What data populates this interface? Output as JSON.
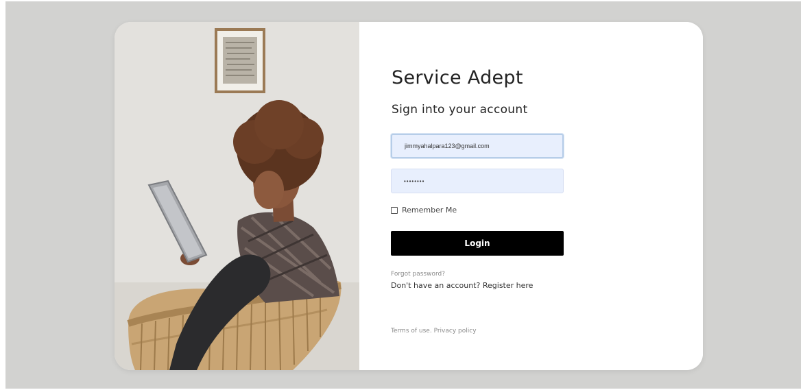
{
  "brand": {
    "title": "Service Adept"
  },
  "form": {
    "heading": "Sign into your account",
    "email_value": "jimmyahalpara123@gmail.com",
    "password_value": "••••••••",
    "remember_label": "Remember Me",
    "remember_checked": false,
    "login_label": "Login",
    "forgot_label": "Forgot password?",
    "register_prefix": "Don't have an account?",
    "register_link": "Register here"
  },
  "footer": {
    "terms_label": "Terms of use.",
    "privacy_label": "Privacy policy"
  },
  "colors": {
    "page_bg": "#d2d2d0",
    "card_bg": "#ffffff",
    "input_bg": "#e8effd",
    "button_bg": "#000000",
    "button_text": "#ffffff"
  },
  "image": {
    "description_icon": "woman-with-tablet-photo"
  }
}
